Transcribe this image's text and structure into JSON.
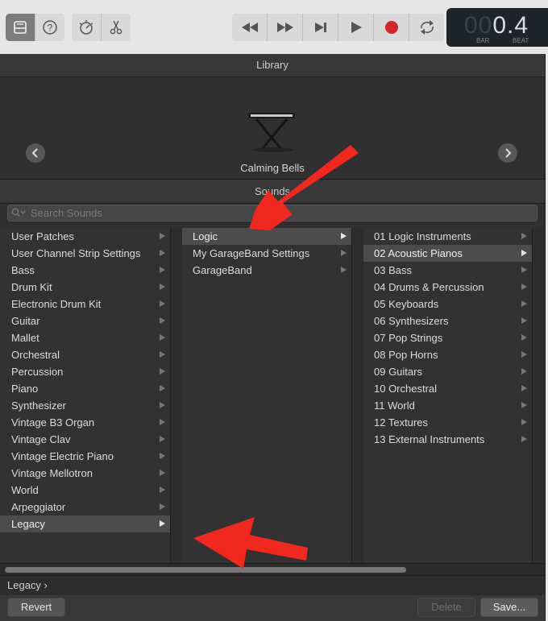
{
  "toolbar": {
    "left_icons": [
      "library-icon",
      "help-icon"
    ],
    "right_icons": [
      "tuner-icon",
      "scissors-icon"
    ],
    "transport_icons": [
      "rewind-icon",
      "fast-forward-icon",
      "skip-to-end-icon",
      "play-icon",
      "record-icon",
      "cycle-icon"
    ],
    "lcd": {
      "value_dim": "00",
      "value": "0.4",
      "bar_label": "BAR",
      "beat_label": "BEAT"
    }
  },
  "library": {
    "title": "Library",
    "patch_name": "Calming Bells",
    "sounds_header": "Sounds",
    "search_placeholder": "Search Sounds"
  },
  "columns": {
    "categories": [
      "User Patches",
      "User Channel Strip Settings",
      "Bass",
      "Drum Kit",
      "Electronic Drum Kit",
      "Guitar",
      "Mallet",
      "Orchestral",
      "Percussion",
      "Piano",
      "Synthesizer",
      "Vintage B3 Organ",
      "Vintage Clav",
      "Vintage Electric Piano",
      "Vintage Mellotron",
      "World",
      "Arpeggiator",
      "Legacy"
    ],
    "sources": [
      "Logic",
      "My GarageBand Settings",
      "GarageBand"
    ],
    "logic_folders": [
      "01 Logic Instruments",
      "02 Acoustic Pianos",
      "03 Bass",
      "04 Drums & Percussion",
      "05 Keyboards",
      "06 Synthesizers",
      "07 Pop Strings",
      "08 Pop Horns",
      "09 Guitars",
      "10 Orchestral",
      "11 World",
      "12 Textures",
      "13 External Instruments"
    ]
  },
  "breadcrumb": {
    "text": "Legacy ›"
  },
  "buttons": {
    "revert": "Revert",
    "delete": "Delete",
    "save": "Save..."
  },
  "colors": {
    "panel_bg": "#2b2b2b",
    "selected_row": "#4c4c4c",
    "annotation_arrow": "#f0281e"
  }
}
